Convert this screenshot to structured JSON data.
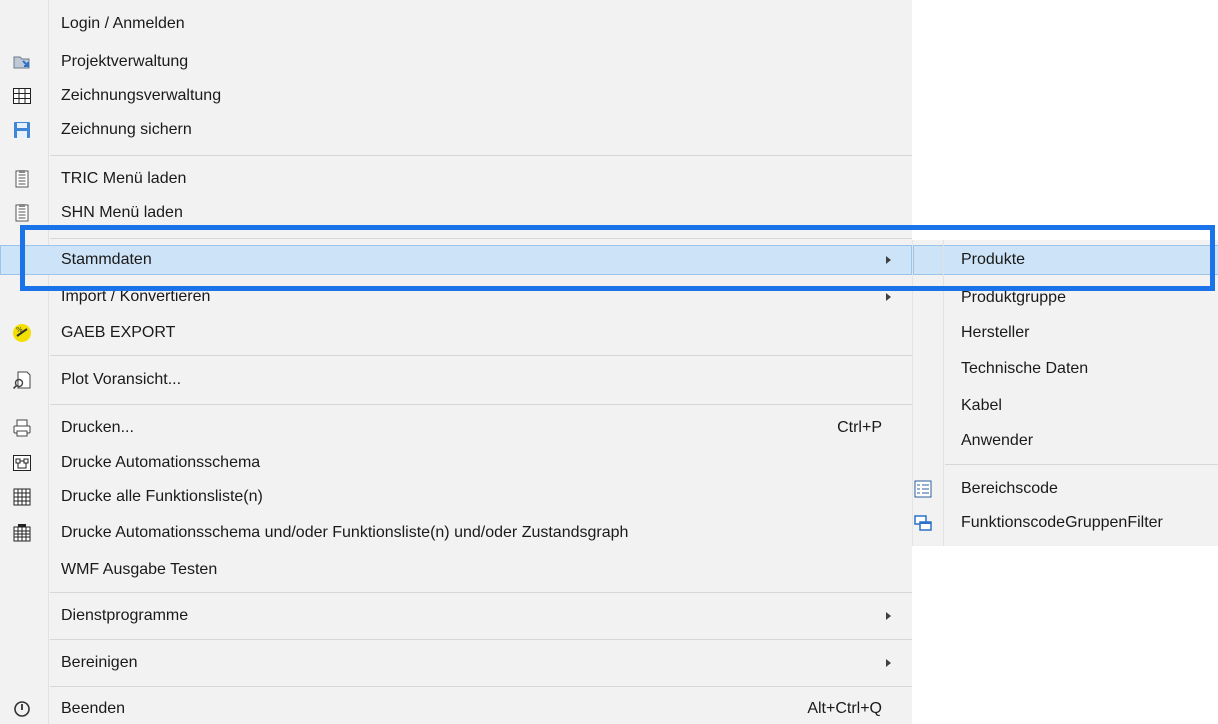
{
  "menu": {
    "items": [
      {
        "label": "Login / Anmelden",
        "icon": "none"
      },
      {
        "label": "Projektverwaltung",
        "icon": "folder-arrow-icon"
      },
      {
        "label": "Zeichnungsverwaltung",
        "icon": "grid-icon"
      },
      {
        "label": "Zeichnung sichern",
        "icon": "save-icon"
      },
      {
        "label": "TRIC Menü laden",
        "icon": "document-icon"
      },
      {
        "label": "SHN Menü laden",
        "icon": "document-icon"
      },
      {
        "label": "Stammdaten",
        "icon": "none",
        "submenu": true
      },
      {
        "label": "Import / Konvertieren",
        "icon": "none",
        "submenu": true
      },
      {
        "label": "GAEB EXPORT",
        "icon": "gaeb-export-icon"
      },
      {
        "label": "Plot Voransicht...",
        "icon": "preview-icon"
      },
      {
        "label": "Drucken...",
        "shortcut": "Ctrl+P",
        "icon": "printer-icon"
      },
      {
        "label": "Drucke Automationsschema",
        "icon": "schema-icon"
      },
      {
        "label": "Drucke alle Funktionsliste(n)",
        "icon": "table-icon"
      },
      {
        "label": "Drucke Automationsschema und/oder Funktionsliste(n) und/oder Zustandsgraph",
        "icon": "table-print-icon"
      },
      {
        "label": "WMF Ausgabe Testen",
        "icon": "none"
      },
      {
        "label": "Dienstprogramme",
        "icon": "none",
        "submenu": true
      },
      {
        "label": "Bereinigen",
        "icon": "none",
        "submenu": true
      },
      {
        "label": "Beenden",
        "shortcut": "Alt+Ctrl+Q",
        "icon": "power-icon"
      }
    ]
  },
  "submenu": {
    "items": [
      {
        "label": "Produkte"
      },
      {
        "label": "Produktgruppe"
      },
      {
        "label": "Hersteller"
      },
      {
        "label": "Technische Daten"
      },
      {
        "label": "Kabel"
      },
      {
        "label": "Anwender"
      },
      {
        "label": "Bereichscode",
        "icon": "list-icon"
      },
      {
        "label": "FunktionscodeGruppenFilter",
        "icon": "windows-icon"
      }
    ]
  },
  "colors": {
    "menu_bg": "#f2f2f2",
    "highlight": "#cde3f7",
    "focus_outline": "#1a73e8"
  }
}
